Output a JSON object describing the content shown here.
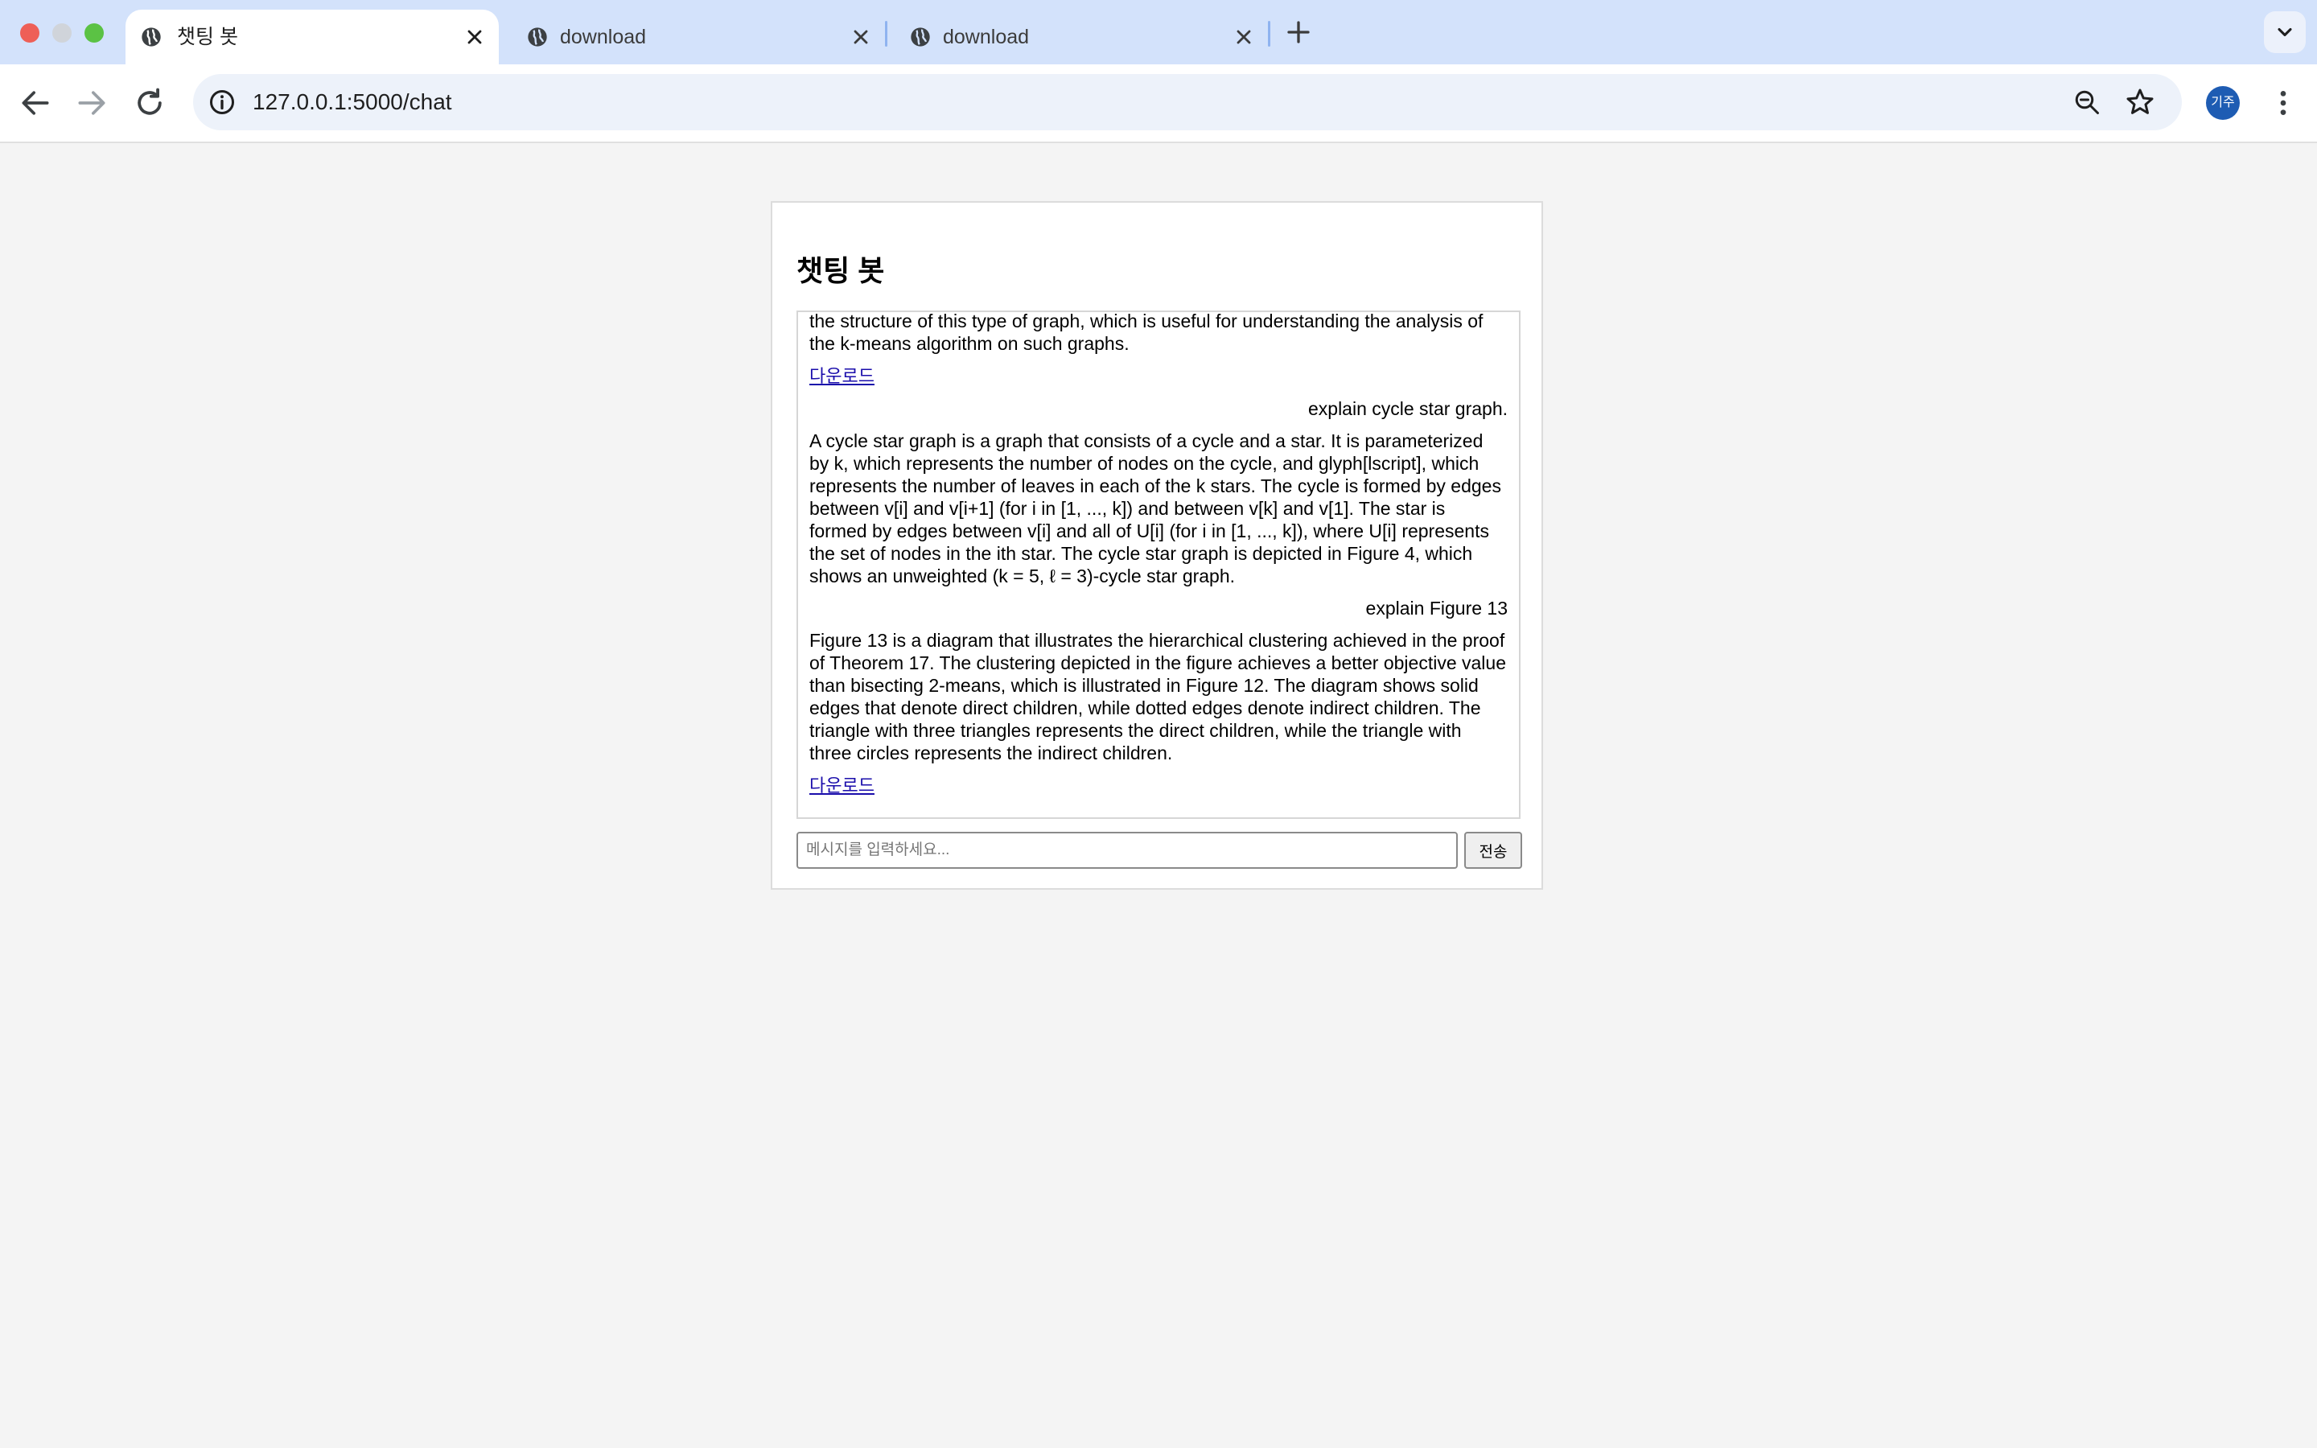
{
  "browser": {
    "tabs": [
      {
        "title": "챗팅 봇",
        "active": true
      },
      {
        "title": "download",
        "active": false
      },
      {
        "title": "download",
        "active": false
      }
    ],
    "url": "127.0.0.1:5000/chat",
    "profile_initials": "기주",
    "accent_color": "#d3e2fb"
  },
  "page": {
    "title": "챗팅 봇",
    "messages": [
      {
        "role": "bot",
        "text": "the structure of this type of graph, which is useful for understanding the analysis of the k-means algorithm on such graphs.",
        "download": "다운로드"
      },
      {
        "role": "user",
        "text": "explain cycle star graph."
      },
      {
        "role": "bot",
        "text": "A cycle star graph is a graph that consists of a cycle and a star. It is parameterized by k, which represents the number of nodes on the cycle, and glyph[lscript], which represents the number of leaves in each of the k stars. The cycle is formed by edges between v[i] and v[i+1] (for i in [1, ..., k]) and between v[k] and v[1]. The star is formed by edges between v[i] and all of U[i] (for i in [1, ..., k]), where U[i] represents the set of nodes in the ith star. The cycle star graph is depicted in Figure 4, which shows an unweighted (k = 5, ℓ = 3)-cycle star graph."
      },
      {
        "role": "user",
        "text": "explain Figure 13"
      },
      {
        "role": "bot",
        "text": "Figure 13 is a diagram that illustrates the hierarchical clustering achieved in the proof of Theorem 17. The clustering depicted in the figure achieves a better objective value than bisecting 2-means, which is illustrated in Figure 12. The diagram shows solid edges that denote direct children, while dotted edges denote indirect children. The triangle with three triangles represents the direct children, while the triangle with three circles represents the indirect children.",
        "download": "다운로드"
      }
    ],
    "input": {
      "placeholder": "메시지를 입력하세요...",
      "value": ""
    },
    "send_label": "전송"
  }
}
